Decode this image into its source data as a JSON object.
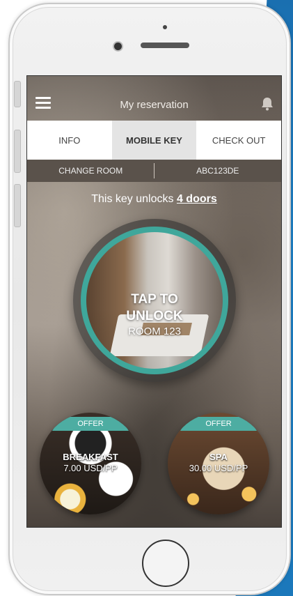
{
  "header": {
    "title": "My reservation"
  },
  "tabs": [
    {
      "label": "INFO",
      "active": false
    },
    {
      "label": "MOBILE KEY",
      "active": true
    },
    {
      "label": "CHECK OUT",
      "active": false
    }
  ],
  "subbar": {
    "change_room": "CHANGE ROOM",
    "code": "ABC123DE"
  },
  "key_info": {
    "prefix": "This key unlocks",
    "doors": "4 doors"
  },
  "unlock": {
    "line1": "TAP TO",
    "line2": "UNLOCK",
    "room": "ROOM 123"
  },
  "offers": [
    {
      "tag": "OFFER",
      "name": "BREAKFAST",
      "price": "7.00 USD/PP"
    },
    {
      "tag": "OFFER",
      "name": "SPA",
      "price": "30.00 USD/PP"
    }
  ],
  "colors": {
    "accent": "#4dada2",
    "phone_body": "#efefef",
    "background_accent": "#1d7fc4"
  },
  "icons": {
    "menu": "hamburger-icon",
    "notifications": "bell-icon"
  }
}
